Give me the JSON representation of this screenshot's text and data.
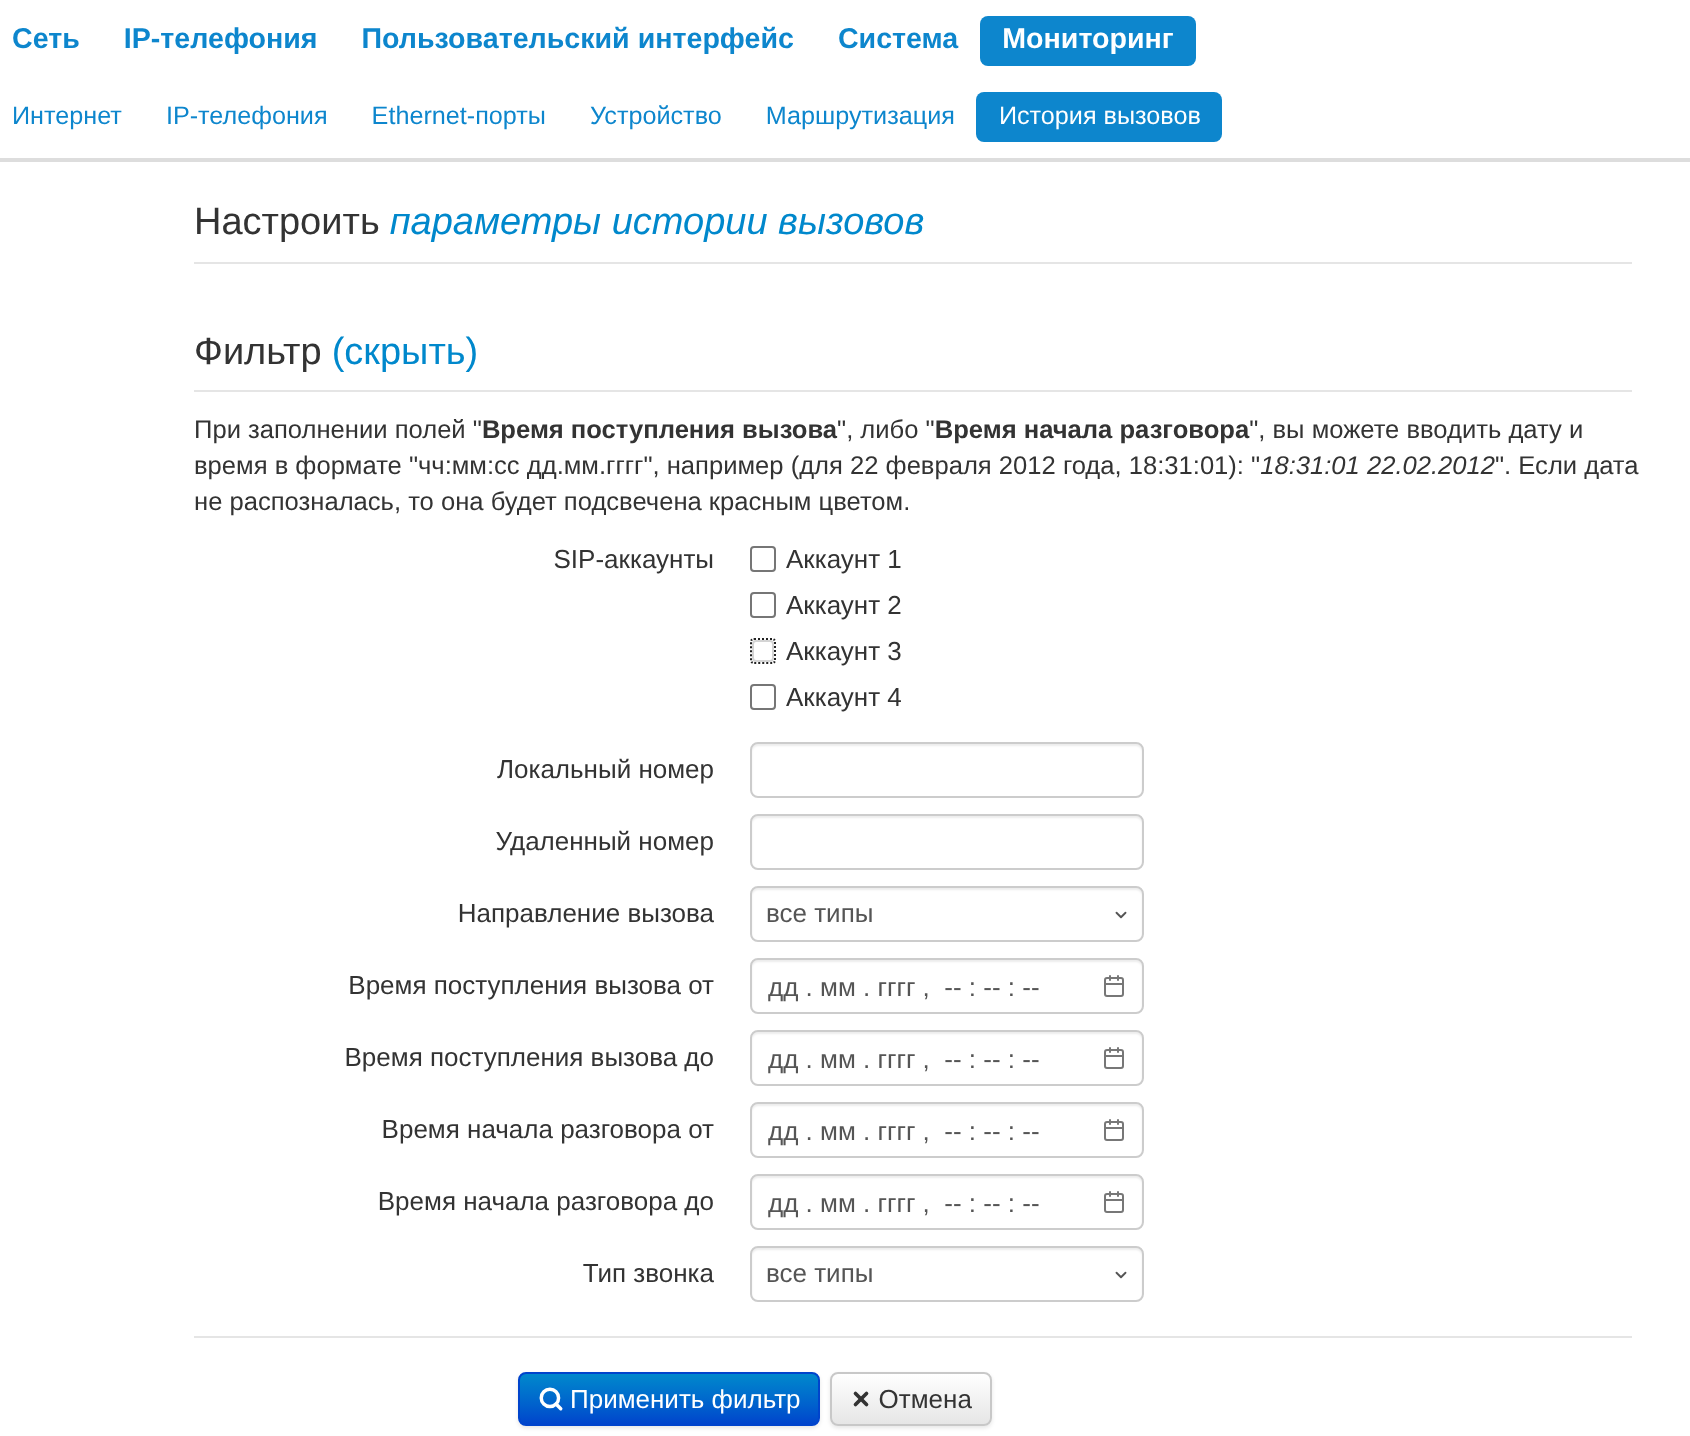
{
  "nav": {
    "main_tabs": [
      {
        "label": "Сеть",
        "selected": false
      },
      {
        "label": "IP-телефония",
        "selected": false
      },
      {
        "label": "Пользовательский интерфейс",
        "selected": false
      },
      {
        "label": "Система",
        "selected": false
      },
      {
        "label": "Мониторинг",
        "selected": true
      }
    ],
    "sub_tabs": [
      {
        "label": "Интернет",
        "selected": false
      },
      {
        "label": "IP-телефония",
        "selected": false
      },
      {
        "label": "Ethernet-порты",
        "selected": false
      },
      {
        "label": "Устройство",
        "selected": false
      },
      {
        "label": "Маршрутизация",
        "selected": false
      },
      {
        "label": "История вызовов",
        "selected": true
      }
    ]
  },
  "settings_heading": {
    "text": "Настроить",
    "link": "параметры истории вызовов"
  },
  "filter": {
    "title": "Фильтр",
    "hide_link": "(скрыть)",
    "hint": "При заполнении полей \"**Время поступления вызова**\", либо \"**Время начала разговора**\", вы можете вводить дату и время в формате \"чч:мм:сс дд.мм.гггг\", например (для 22 февраля 2012 года, 18:31:01): \"*18:31:01 22.02.2012*\". Если дата не распозналась, то она будет подсвечена красным цветом.",
    "fields": [
      {
        "kind": "checkboxes",
        "label": "SIP-аккаунты",
        "options": [
          {
            "label": "Аккаунт 1",
            "checked": false,
            "focused": false
          },
          {
            "label": "Аккаунт 2",
            "checked": false,
            "focused": false
          },
          {
            "label": "Аккаунт 3",
            "checked": false,
            "focused": true
          },
          {
            "label": "Аккаунт 4",
            "checked": false,
            "focused": false
          }
        ]
      },
      {
        "kind": "text",
        "label": "Локальный номер"
      },
      {
        "kind": "text",
        "label": "Удаленный номер"
      },
      {
        "kind": "select",
        "label": "Направление вызова",
        "value": "все типы"
      },
      {
        "kind": "datetime",
        "label": "Время поступления вызова от",
        "placeholder": "дд . мм . гггг ,  -- : -- : --"
      },
      {
        "kind": "datetime",
        "label": "Время поступления вызова до",
        "placeholder": "дд . мм . гггг ,  -- : -- : --"
      },
      {
        "kind": "datetime",
        "label": "Время начала разговора от",
        "placeholder": "дд . мм . гггг ,  -- : -- : --"
      },
      {
        "kind": "datetime",
        "label": "Время начала разговора до",
        "placeholder": "дд . мм . гггг ,  -- : -- : --"
      },
      {
        "kind": "select",
        "label": "Тип звонка",
        "value": "все типы"
      }
    ]
  },
  "buttons": [
    {
      "kind": "apply",
      "label": "Применить фильтр"
    },
    {
      "kind": "cancel",
      "label": "Отмена"
    }
  ]
}
